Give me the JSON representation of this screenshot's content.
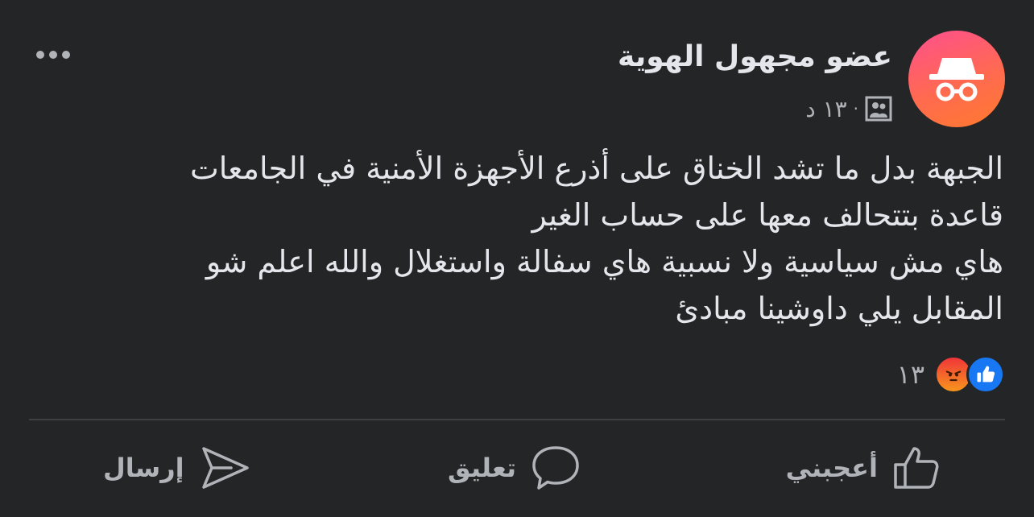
{
  "post": {
    "author": "عضو مجهول الهوية",
    "time": "١٣ د",
    "separator": "·",
    "audience_icon": "group-icon",
    "more_icon": "more-options-icon",
    "avatar_icon": "incognito-icon",
    "body_lines": [
      "الجبهة بدل ما تشد الخناق على أذرع الأجهزة الأمنية في الجامعات",
      "قاعدة بتتحالف معها على حساب الغير",
      "هاي مش سياسية ولا نسبية هاي سفالة واستغلال والله اعلم شو",
      "المقابل يلي داوشينا مبادئ"
    ]
  },
  "reactions": {
    "types": [
      "like",
      "angry"
    ],
    "count": "١٣"
  },
  "actions": {
    "like_label": "أعجبني",
    "comment_label": "تعليق",
    "send_label": "إرسال"
  },
  "colors": {
    "background": "#242526",
    "text_primary": "#e4e6eb",
    "text_secondary": "#b0b3b8",
    "like_blue": "#1877f2",
    "avatar_pink": "#ff4f8f"
  }
}
